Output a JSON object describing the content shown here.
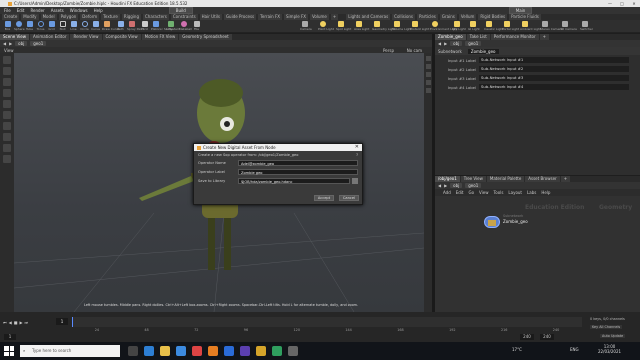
{
  "window": {
    "title": "C:/Users/Admin/Desktop/Zombie/Zombie.hiplc - Houdini FX Education Edition 18.5.532",
    "controls": [
      "—",
      "□",
      "✕"
    ]
  },
  "menubar": {
    "items": [
      "File",
      "Edit",
      "Render",
      "Assets",
      "Windows",
      "Help"
    ],
    "build_label": "Build",
    "main_label": "Main"
  },
  "shelf": {
    "tabs": [
      "Create",
      "Modify",
      "Model",
      "Polygon",
      "Deform",
      "Texture",
      "Rigging",
      "Characters",
      "Constraints",
      "Hair Utils",
      "Guide Process",
      "Terrain FX",
      "Simple FX",
      "Volume",
      "+"
    ],
    "tools": [
      "Box",
      "Sphere",
      "Tube",
      "Torus",
      "Grid",
      "Null",
      "Line",
      "Circle",
      "Curve",
      "Draw Curve",
      "Path",
      "Spray Paint",
      "Font",
      "Platonic Solids",
      "L-System",
      "Metaball",
      "File"
    ],
    "lights_tabs": [
      "Lights and Cameras",
      "Collisions",
      "Particles",
      "Grains",
      "Vellum",
      "Rigid Bodies",
      "Particle Fluids",
      "Viscous Fluids",
      "Oceans",
      "Pyro FX",
      "FEM",
      "Wires",
      "Crowds",
      "Drive Simulation"
    ],
    "lights": [
      "Camera",
      "Point Light",
      "Spot Light",
      "Area Light",
      "Geometry Light",
      "Volume Light",
      "Distant Light",
      "Environment Light",
      "Sky Light",
      "GI Light",
      "Caustic Light",
      "Portal Light",
      "Ambient Light",
      "Stereo Camera",
      "VR Camera",
      "Switcher"
    ]
  },
  "left_pane": {
    "tabs": [
      "Scene View",
      "Animation Editor",
      "Render View",
      "Composite View",
      "Motion FX View",
      "Geometry Spreadsheet"
    ],
    "path": [
      "obj",
      "geo1"
    ],
    "view_label": "View",
    "camera_labels": [
      "Persp",
      "No cam"
    ],
    "status_hint": "Left mouse tumbles. Middle pans. Right dollies. Ctrl+Alt+Left box-zooms. Ctrl+Right zooms. Spacebar-Ctrl-Left tilts. Hold L for alternate tumble, dolly, and zoom."
  },
  "dialog": {
    "title": "Create New Digital Asset From Node",
    "description": "Create a new Sop operator from: /obj/geo1/Zombie_geo",
    "fields": [
      {
        "label": "Operator Name",
        "value": "Adel@zombie_geo"
      },
      {
        "label": "Operator Label",
        "value": "Zombie geo"
      },
      {
        "label": "Save to Library",
        "value": "$JOB/hda/zombie_geo.hdanc"
      }
    ],
    "accept_label": "Accept",
    "cancel_label": "Cancel",
    "help_label": "?",
    "close_label": "✕"
  },
  "right_top": {
    "tabs": [
      "Zombie_geo",
      "Take List",
      "Performance Monitor",
      "+"
    ],
    "path": [
      "obj",
      "geo1"
    ],
    "node_type": "Subnetwork",
    "node_name": "Zombie_geo",
    "params": [
      {
        "label": "Input #1 Label",
        "value": "Sub-Network Input #1"
      },
      {
        "label": "Input #2 Label",
        "value": "Sub-Network Input #2"
      },
      {
        "label": "Input #3 Label",
        "value": "Sub-Network Input #3"
      },
      {
        "label": "Input #4 Label",
        "value": "Sub-Network Input #4"
      }
    ]
  },
  "right_bottom": {
    "tabs": [
      "/obj/geo1",
      "Tree View",
      "Material Palette",
      "Asset Browser",
      "+"
    ],
    "path": [
      "obj",
      "geo1"
    ],
    "menu": [
      "Add",
      "Edit",
      "Go",
      "View",
      "Tools",
      "Layout",
      "Labs",
      "Help"
    ],
    "watermark_left": "Education Edition",
    "watermark_right": "Geometry",
    "node_label": "Zombie_geo",
    "node_sublabel": "Subnetwork"
  },
  "timeline": {
    "frame": "1",
    "start": "1",
    "end": "240",
    "end2": "240",
    "ticks": [
      "24",
      "48",
      "72",
      "96",
      "120",
      "144",
      "168",
      "192",
      "216",
      "240"
    ],
    "keys_label": "0 keys, 0/0 channels",
    "keyall_label": "Key All Channels",
    "autoupdate_label": "Auto Update"
  },
  "taskbar": {
    "search_placeholder": "Type here to search",
    "temp": "17°C",
    "time": "13:00",
    "date": "22/03/2021",
    "lang": "ENG"
  },
  "colors": {
    "accent": "#e8a23a",
    "node_blue": "#5a7fd0"
  }
}
